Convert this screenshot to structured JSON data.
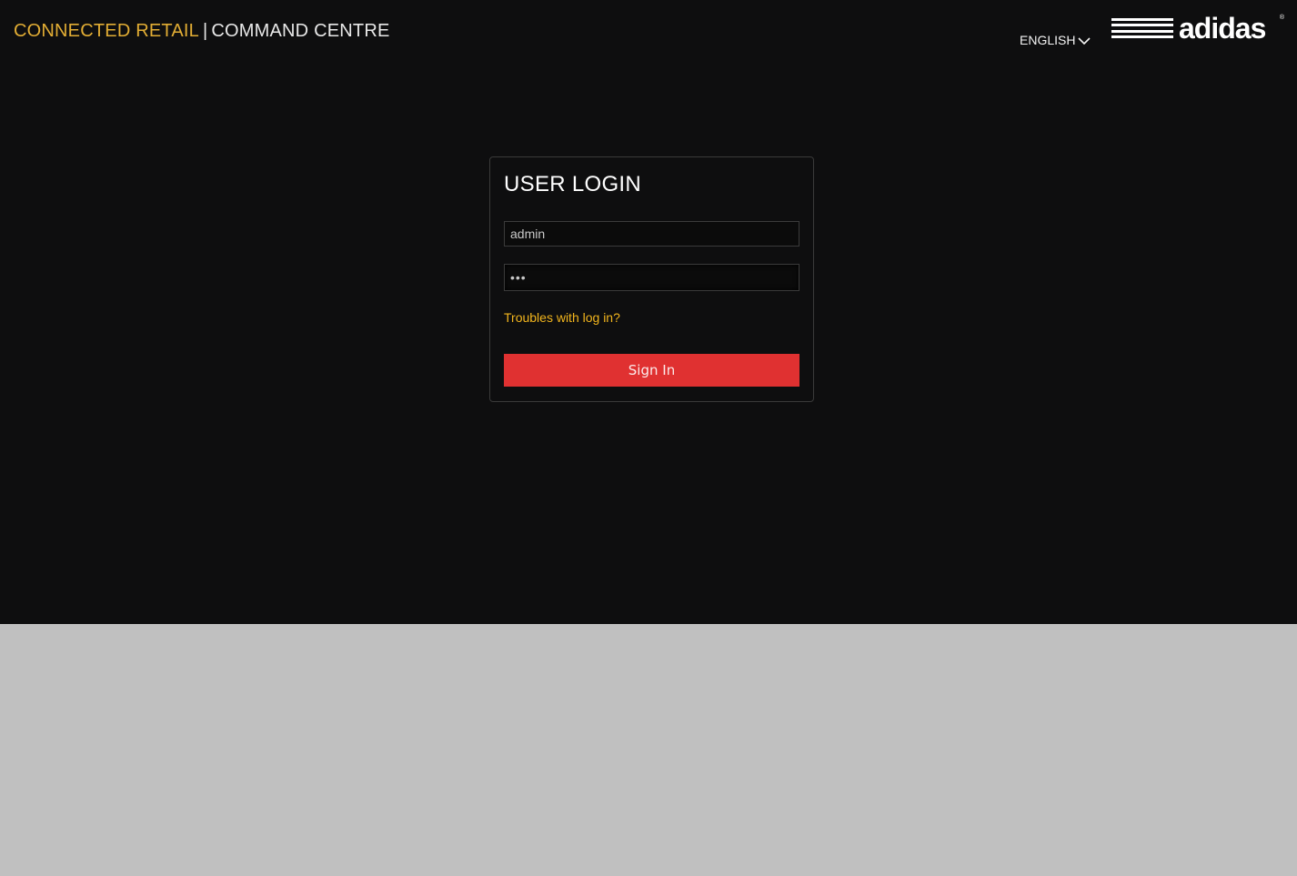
{
  "header": {
    "brand_accent": "CONNECTED RETAIL",
    "brand_separator": "|",
    "brand_rest": "COMMAND CENTRE",
    "language": "ENGLISH",
    "logo_text": "adidas",
    "logo_mark": "®"
  },
  "login": {
    "title": "USER LOGIN",
    "username_value": "admin",
    "password_value": "•••",
    "trouble_link": "Troubles with log in?",
    "signin_label": "Sign In"
  },
  "colors": {
    "background_dark": "#0e0e0f",
    "background_bottom": "#c0c0c0",
    "accent_yellow": "#e2ad34",
    "link_yellow": "#f2b51d",
    "button_red": "#e03131"
  },
  "icons": {
    "language_dropdown": "chevron-down-icon",
    "logo": "adidas-stripes-logo"
  }
}
